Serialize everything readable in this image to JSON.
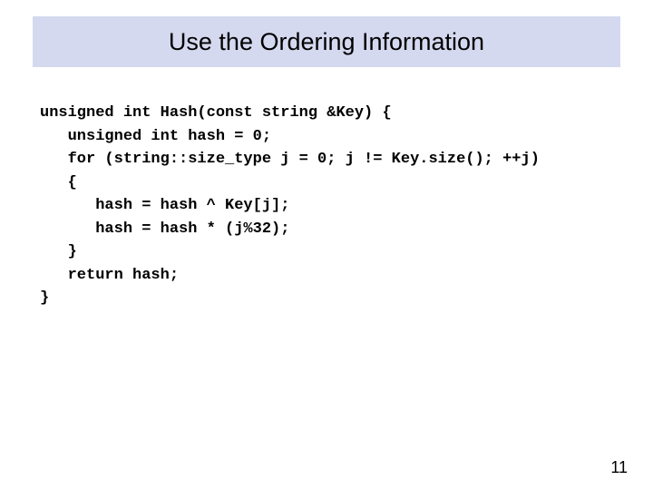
{
  "title": "Use the Ordering Information",
  "code": {
    "l1": "unsigned int Hash(const string &Key) {",
    "l2": "   unsigned int hash = 0;",
    "l3": "   for (string::size_type j = 0; j != Key.size(); ++j)",
    "l4": "   {",
    "l5": "      hash = hash ^ Key[j];",
    "l6": "      hash = hash * (j%32);",
    "l7": "   }",
    "l8": "   return hash;",
    "l9": "}"
  },
  "page_number": "11"
}
